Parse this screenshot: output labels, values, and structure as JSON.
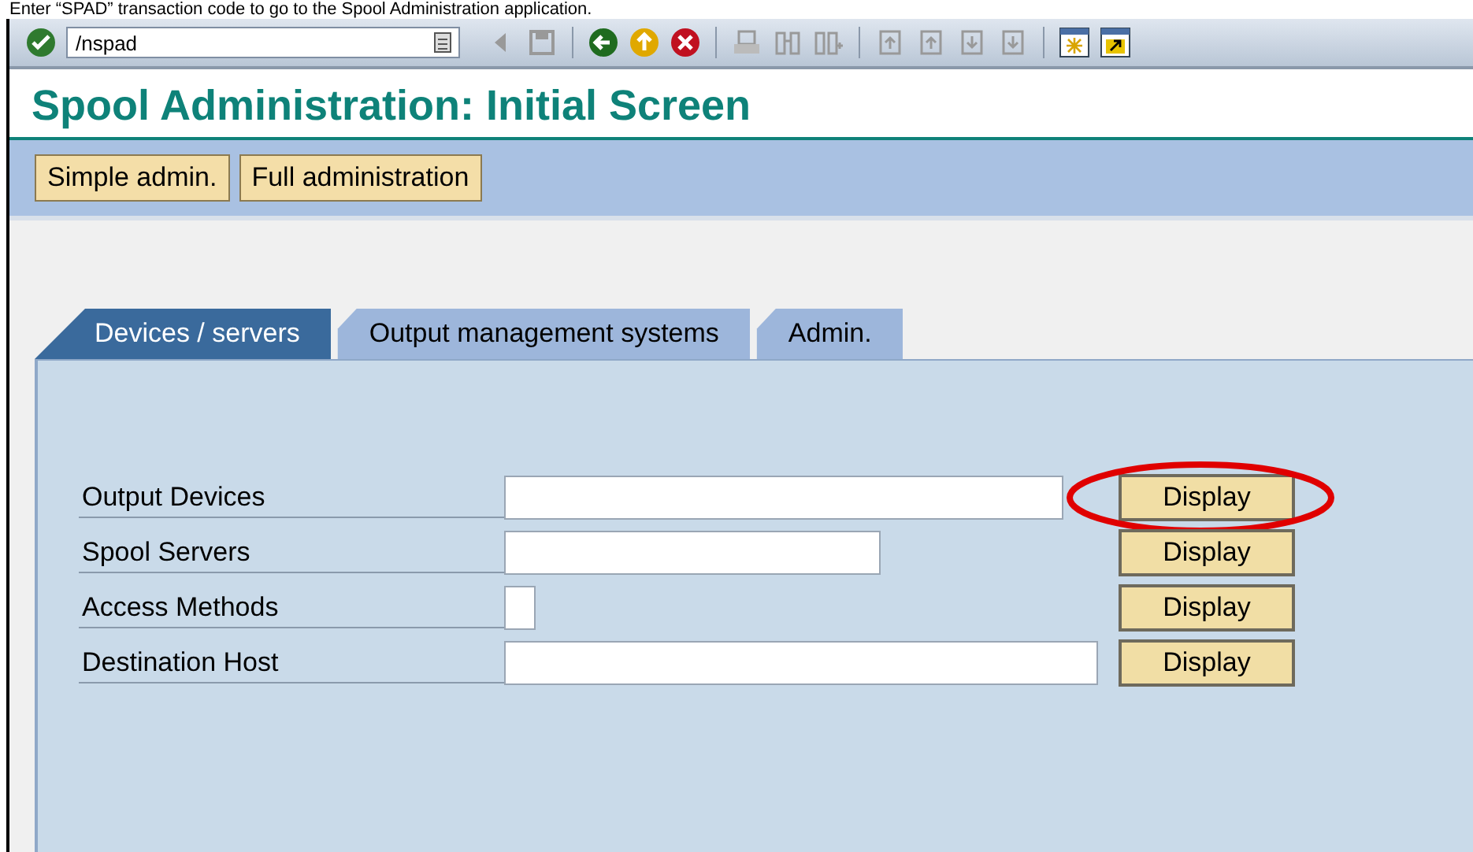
{
  "caption": "Enter “SPAD” transaction code to go to the Spool Administration application.",
  "toolbar": {
    "command_field": {
      "value": "/nspad"
    }
  },
  "title": "Spool Administration: Initial Screen",
  "app_buttons": [
    "Simple admin.",
    "Full administration"
  ],
  "tabs": [
    {
      "label": "Devices / servers",
      "selected": true
    },
    {
      "label": "Output management systems",
      "selected": false
    },
    {
      "label": "Admin.",
      "selected": false
    }
  ],
  "rows": [
    {
      "label": "Output Devices",
      "button": "Display",
      "highlighted": true
    },
    {
      "label": "Spool Servers",
      "button": "Display",
      "highlighted": false
    },
    {
      "label": "Access Methods",
      "button": "Display",
      "highlighted": false
    },
    {
      "label": "Destination Host",
      "button": "Display",
      "highlighted": false
    }
  ]
}
